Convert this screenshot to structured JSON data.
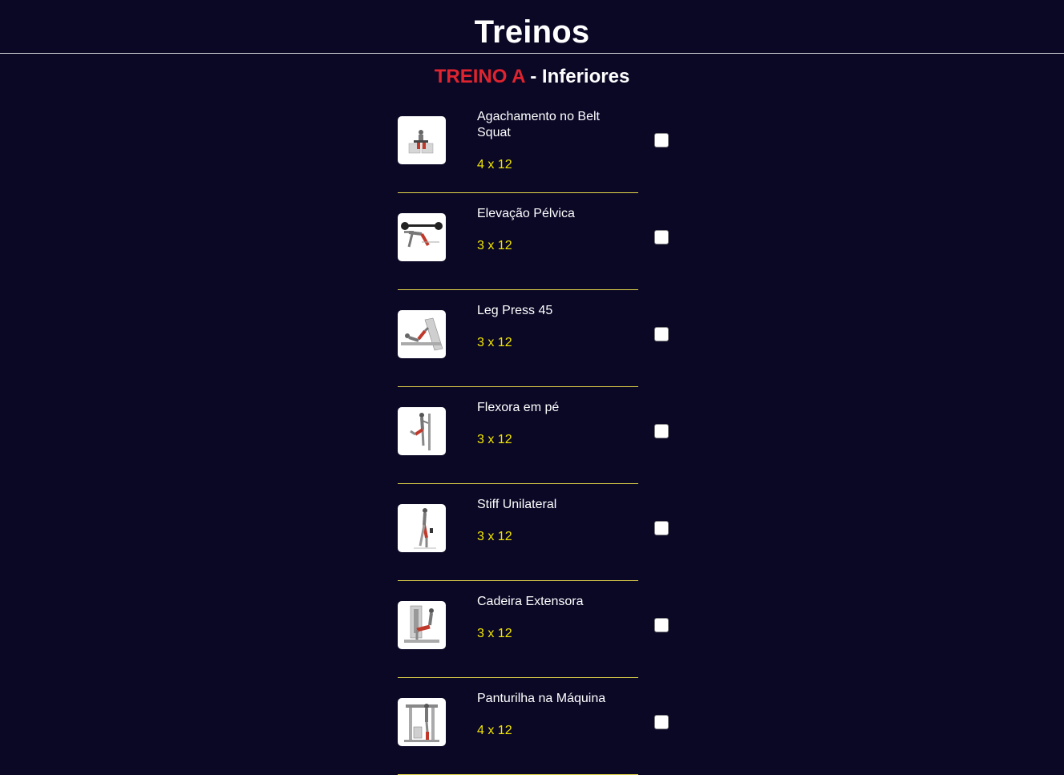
{
  "header": {
    "title": "Treinos"
  },
  "section": {
    "label_red": "TREINO A",
    "separator": " - ",
    "label_white": "Inferiores"
  },
  "colors": {
    "background": "#0b0826",
    "accent_red": "#e0242f",
    "reps_yellow": "#f2e600",
    "divider_yellow": "#e8d84a"
  },
  "exercises": [
    {
      "name": "Agachamento no Belt Squat",
      "reps": "4 x 12",
      "image": "belt-squat-illustration",
      "checked": false
    },
    {
      "name": "Elevação Pélvica",
      "reps": "3 x 12",
      "image": "hip-thrust-illustration",
      "checked": false
    },
    {
      "name": "Leg Press 45",
      "reps": "3 x 12",
      "image": "leg-press-illustration",
      "checked": false
    },
    {
      "name": "Flexora em pé",
      "reps": "3 x 12",
      "image": "standing-leg-curl-illustration",
      "checked": false
    },
    {
      "name": "Stiff Unilateral",
      "reps": "3 x 12",
      "image": "single-leg-stiff-illustration",
      "checked": false
    },
    {
      "name": "Cadeira Extensora",
      "reps": "3 x 12",
      "image": "leg-extension-illustration",
      "checked": false
    },
    {
      "name": "Panturilha na Máquina",
      "reps": "4 x 12",
      "image": "calf-machine-illustration",
      "checked": false
    }
  ]
}
